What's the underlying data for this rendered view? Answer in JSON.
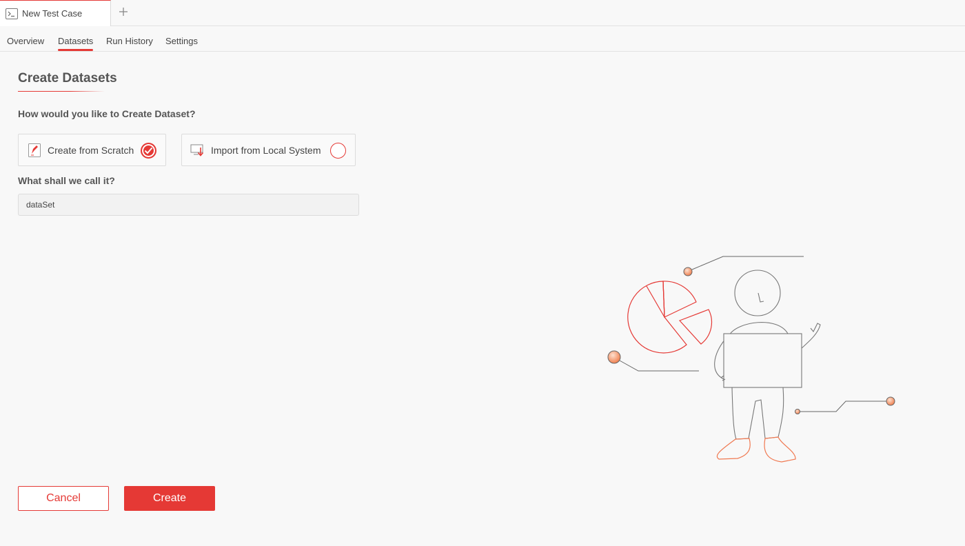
{
  "tabs": [
    {
      "label": "New Test Case",
      "active": true
    }
  ],
  "tab_add_symbol": "+",
  "subnav": {
    "items": [
      {
        "label": "Overview"
      },
      {
        "label": "Datasets",
        "active": true
      },
      {
        "label": "Run History"
      },
      {
        "label": "Settings"
      }
    ]
  },
  "form": {
    "title": "Create Datasets",
    "question": "How would you like to Create Dataset?",
    "options": [
      {
        "label": "Create from Scratch",
        "icon": "pencil-file-icon",
        "selected": true
      },
      {
        "label": "Import from Local System",
        "icon": "import-monitor-icon",
        "selected": false
      }
    ],
    "name_label": "What shall we call it?",
    "name_value": "dataSet"
  },
  "actions": {
    "cancel_label": "Cancel",
    "create_label": "Create"
  },
  "colors": {
    "accent": "#e53935",
    "background": "#f8f8f8",
    "text": "#444444"
  }
}
